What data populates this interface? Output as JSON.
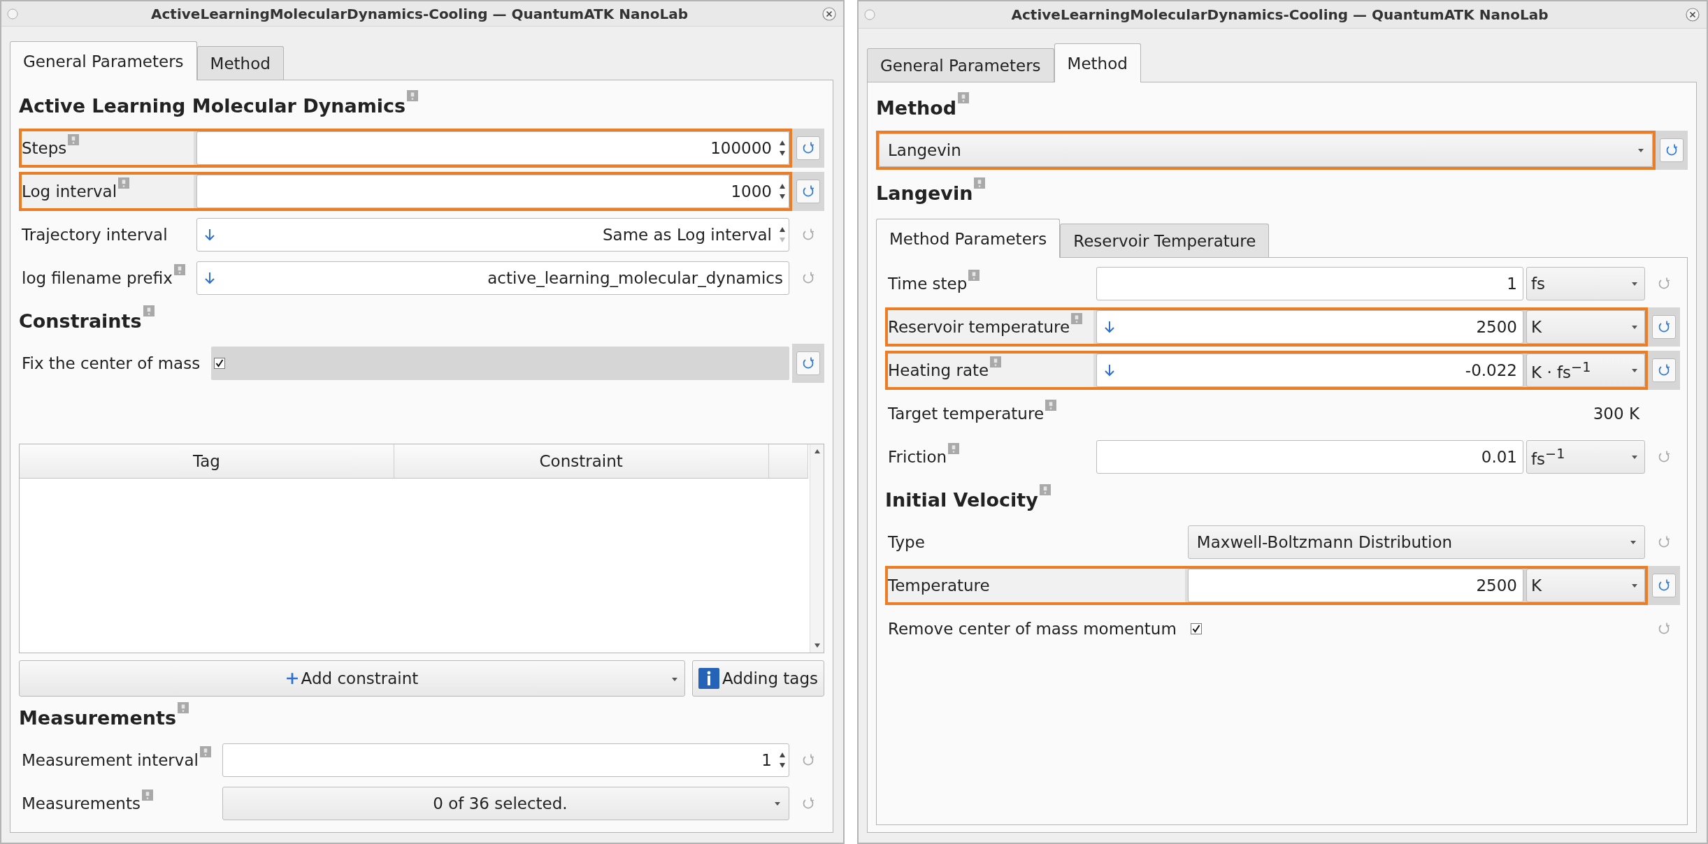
{
  "windows": [
    {
      "title": "ActiveLearningMolecularDynamics-Cooling — QuantumATK NanoLab",
      "tabs": [
        {
          "label": "General Parameters",
          "selected": true
        },
        {
          "label": "Method",
          "selected": false
        }
      ],
      "groups": [
        {
          "kind": "plain",
          "sections": [
            {
              "heading": "Active Learning Molecular Dynamics",
              "help": true,
              "rows": [
                {
                  "kind": "spin",
                  "label": "Steps",
                  "help": true,
                  "value": "100000",
                  "linked": false,
                  "highlighted": true,
                  "modified": true
                },
                {
                  "kind": "spin",
                  "label": "Log interval",
                  "help": true,
                  "value": "1000",
                  "linked": false,
                  "highlighted": true,
                  "modified": true
                },
                {
                  "kind": "spin",
                  "label": "Trajectory interval",
                  "help": false,
                  "value": "Same as Log interval",
                  "linked": true,
                  "highlighted": false,
                  "modified": false
                },
                {
                  "kind": "text",
                  "label": "log filename prefix",
                  "help": true,
                  "value": "active_learning_molecular_dynamics",
                  "linked": true,
                  "highlighted": false,
                  "modified": false
                }
              ]
            },
            {
              "heading": "Constraints",
              "help": true,
              "rows": [
                {
                  "kind": "check",
                  "label": "Fix the center of mass",
                  "help": false,
                  "checked": true,
                  "highlighted": false,
                  "modified": true
                },
                {
                  "kind": "table",
                  "columns": [
                    "Tag",
                    "Constraint"
                  ]
                },
                {
                  "kind": "buttons",
                  "buttons": [
                    {
                      "kind": "add",
                      "label": "Add constraint"
                    },
                    {
                      "kind": "info",
                      "label": "Adding tags"
                    }
                  ]
                }
              ]
            },
            {
              "heading": "Measurements",
              "help": true,
              "rows": [
                {
                  "kind": "spin",
                  "label": "Measurement interval",
                  "help": true,
                  "value": "1",
                  "linked": false,
                  "highlighted": false,
                  "modified": false
                },
                {
                  "kind": "multiselect",
                  "label": "Measurements",
                  "help": true,
                  "value": "0 of 36 selected.",
                  "highlighted": false,
                  "modified": false
                }
              ]
            }
          ]
        }
      ]
    },
    {
      "title": "ActiveLearningMolecularDynamics-Cooling — QuantumATK NanoLab",
      "tabs": [
        {
          "label": "General Parameters",
          "selected": false
        },
        {
          "label": "Method",
          "selected": true
        }
      ],
      "groups": [
        {
          "kind": "plain",
          "sections": [
            {
              "heading": "Method",
              "help": true,
              "rows": [
                {
                  "kind": "combo",
                  "value": "Langevin",
                  "highlighted": true,
                  "modified": true
                }
              ]
            },
            {
              "heading": "Langevin",
              "help": true
            }
          ]
        },
        {
          "kind": "tabpanel",
          "tabs": [
            {
              "label": "Method Parameters",
              "selected": true
            },
            {
              "label": "Reservoir Temperature",
              "selected": false
            }
          ],
          "sections": [
            {
              "rows": [
                {
                  "kind": "quantity",
                  "label": "Time step",
                  "help": true,
                  "value": "1",
                  "unit": "fs",
                  "linked": false,
                  "highlighted": false,
                  "modified": false
                },
                {
                  "kind": "quantity",
                  "label": "Reservoir temperature",
                  "help": true,
                  "value": "2500",
                  "unit": "K",
                  "linked": true,
                  "highlighted": true,
                  "modified": true
                },
                {
                  "kind": "quantity",
                  "label": "Heating rate",
                  "help": true,
                  "value": "-0.022",
                  "unit": "K · fs$^{−1}$",
                  "linked": true,
                  "highlighted": true,
                  "modified": true
                },
                {
                  "kind": "readout",
                  "label": "Target temperature",
                  "help": true,
                  "value": "300 K",
                  "highlighted": false
                },
                {
                  "kind": "quantity",
                  "label": "Friction",
                  "help": true,
                  "value": "0.01",
                  "unit": "fs$^{−1}$",
                  "linked": false,
                  "highlighted": false,
                  "modified": false
                }
              ]
            },
            {
              "heading": "Initial Velocity",
              "help": true,
              "rows": [
                {
                  "kind": "combo",
                  "label": "Type",
                  "help": false,
                  "value": "Maxwell-Boltzmann Distribution",
                  "highlighted": false,
                  "modified": false
                },
                {
                  "kind": "quantity",
                  "label": "Temperature",
                  "help": false,
                  "value": "2500",
                  "unit": "K",
                  "linked": false,
                  "highlighted": true,
                  "modified": true
                },
                {
                  "kind": "check",
                  "label": "Remove center of mass momentum",
                  "help": false,
                  "checked": true,
                  "highlighted": false,
                  "modified": false
                }
              ]
            }
          ]
        }
      ]
    }
  ]
}
